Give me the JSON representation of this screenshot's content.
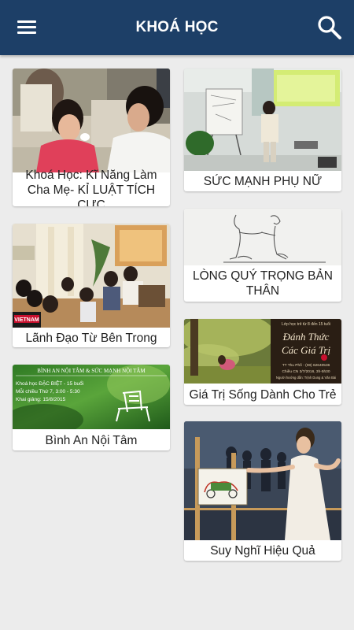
{
  "header": {
    "title": "KHOÁ HỌC",
    "menu_icon": "menu-icon",
    "search_icon": "search-icon",
    "bg_color": "#1d3f67"
  },
  "courses_left": [
    {
      "title": "Khoá Học: Kĩ Năng Làm Cha Mẹ- KỈ LUẬT TÍCH CỰC"
    },
    {
      "title": "Lãnh Đạo Từ Bên Trong",
      "image_text": "VIETNAM"
    },
    {
      "title": "Bình An Nội Tâm",
      "image_text": {
        "heading": "BÌNH AN NỘI TÂM & SỨC MẠNH NỘI TÂM",
        "line1": "Khoá học ĐẶC BIỆT - 15 buổi",
        "line2": "Mỗi chiều Thứ 7, 3:00 - 5:30",
        "line3": "Khai giảng: 15/8/2015"
      }
    }
  ],
  "courses_right": [
    {
      "title": "SỨC MẠNH PHỤ NỮ"
    },
    {
      "title": "LÒNG QUÝ TRỌNG BẢN THÂN"
    },
    {
      "title": "Giá Trị Sống Dành Cho Trẻ",
      "image_text": {
        "line1": "Lớp học trẻ từ 8 đến 15 tuổi",
        "heading1": "Đánh Thức",
        "heading2": "Các Giá Trị",
        "info1": "TT Thu Phố - (08) 62640536",
        "info2": "Chiều CN 3/7/2016, 3h-5h30",
        "info3": "Người hướng dẫn: Trịnh Dung & Văn Bài"
      }
    },
    {
      "title": "Suy Nghĩ Hiệu Quả"
    }
  ]
}
